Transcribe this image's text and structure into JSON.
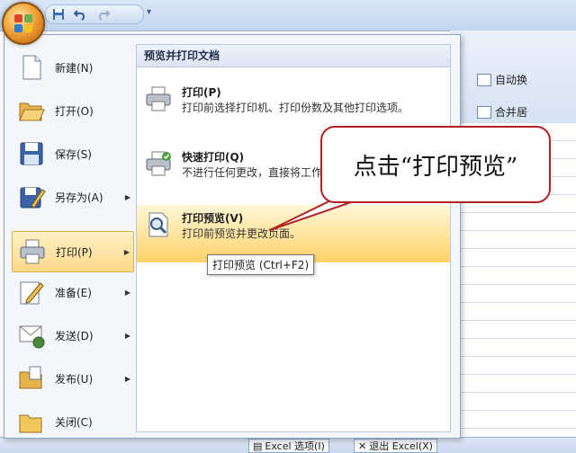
{
  "qat": {
    "save": "save-icon",
    "undo": "undo-icon",
    "redo": "redo-icon",
    "customize": "▾"
  },
  "ribbon": {
    "auto_label": "自动换",
    "merge_label": "合并居"
  },
  "menu": {
    "items": [
      {
        "label": "新建(N)",
        "icon": "new-document-icon",
        "has_submenu": false
      },
      {
        "label": "打开(O)",
        "icon": "open-folder-icon",
        "has_submenu": false
      },
      {
        "label": "保存(S)",
        "icon": "save-disk-icon",
        "has_submenu": false
      },
      {
        "label": "另存为(A)",
        "icon": "save-as-icon",
        "has_submenu": true
      },
      {
        "label": "打印(P)",
        "icon": "printer-icon",
        "has_submenu": true,
        "active": true
      },
      {
        "label": "准备(E)",
        "icon": "prepare-pen-icon",
        "has_submenu": true
      },
      {
        "label": "发送(D)",
        "icon": "send-icon",
        "has_submenu": true
      },
      {
        "label": "发布(U)",
        "icon": "publish-icon",
        "has_submenu": true
      },
      {
        "label": "关闭(C)",
        "icon": "close-folder-icon",
        "has_submenu": false
      }
    ],
    "arrow": "▶"
  },
  "panel": {
    "heading": "预览并打印文档",
    "options": [
      {
        "title": "打印(P)",
        "desc": "打印前选择打印机、打印份数及其他打印选项。",
        "icon": "printer-icon"
      },
      {
        "title": "快速打印(Q)",
        "desc": "不进行任何更改，直接将工作簿发送到默认打印机。",
        "icon": "quick-print-icon"
      },
      {
        "title": "打印预览(V)",
        "desc": "打印前预览并更改页面。",
        "icon": "print-preview-icon",
        "highlighted": true
      }
    ],
    "tooltip": "打印预览 (Ctrl+F2)"
  },
  "status": {
    "options_button": "Excel 选项(I)",
    "exit_button": "退出 Excel(X)"
  },
  "callout": {
    "text": "点击“打印预览”",
    "border_color": "#b22222"
  },
  "colors": {
    "accent": "#ffd36b",
    "frame": "#8ba6cc"
  }
}
